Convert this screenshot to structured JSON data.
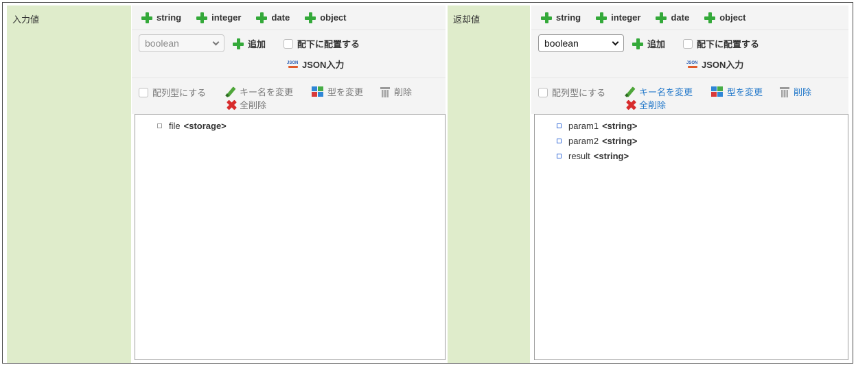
{
  "input": {
    "label": "入力値",
    "type_buttons": [
      "string",
      "integer",
      "date",
      "object"
    ],
    "type_select": {
      "value": "boolean"
    },
    "add_label": "追加",
    "child_checkbox_label": "配下に配置する",
    "json_label": "JSON入力",
    "json_icon_text": "JSON",
    "array_checkbox_label": "配列型にする",
    "rename_label": "キー名を変更",
    "change_type_label": "型を変更",
    "delete_label": "削除",
    "delete_all_label": "全削除",
    "tree": [
      {
        "name": "file",
        "type": "<storage>"
      }
    ]
  },
  "output": {
    "label": "返却値",
    "type_buttons": [
      "string",
      "integer",
      "date",
      "object"
    ],
    "type_select": {
      "value": "boolean"
    },
    "add_label": "追加",
    "child_checkbox_label": "配下に配置する",
    "json_label": "JSON入力",
    "json_icon_text": "JSON",
    "array_checkbox_label": "配列型にする",
    "rename_label": "キー名を変更",
    "change_type_label": "型を変更",
    "delete_label": "削除",
    "delete_all_label": "全削除",
    "tree": [
      {
        "name": "param1",
        "type": "<string>"
      },
      {
        "name": "param2",
        "type": "<string>"
      },
      {
        "name": "result",
        "type": "<string>"
      }
    ]
  },
  "colors": {
    "label_bg": "#dfeccb",
    "toolbar_bg": "#f4f4f4",
    "plus_green": "#34a93a",
    "link_blue": "#1f76c9",
    "delete_red": "#d82c2c"
  }
}
